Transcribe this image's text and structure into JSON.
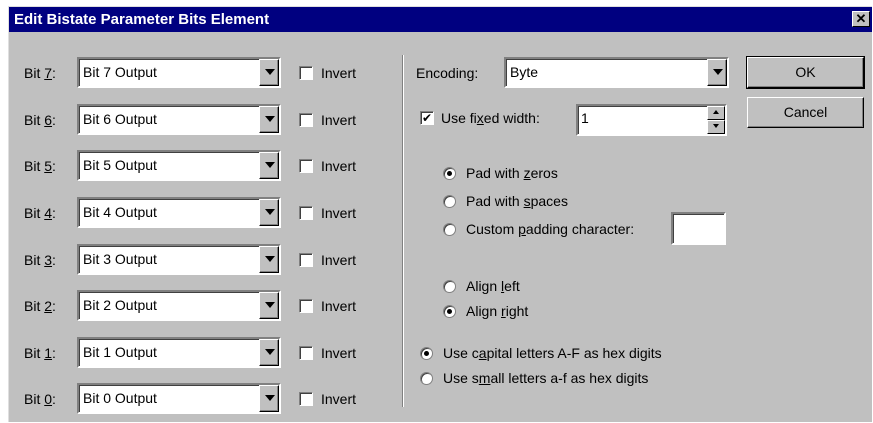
{
  "window": {
    "title": "Edit Bistate Parameter Bits Element",
    "close_label": "✕"
  },
  "bits": [
    {
      "label_pre": "Bit ",
      "label_key": "7",
      "label_post": ":",
      "value": "Bit 7 Output",
      "invert_label": "Invert",
      "invert_checked": false
    },
    {
      "label_pre": "Bit ",
      "label_key": "6",
      "label_post": ":",
      "value": "Bit 6 Output",
      "invert_label": "Invert",
      "invert_checked": false
    },
    {
      "label_pre": "Bit ",
      "label_key": "5",
      "label_post": ":",
      "value": "Bit 5 Output",
      "invert_label": "Invert",
      "invert_checked": false
    },
    {
      "label_pre": "Bit ",
      "label_key": "4",
      "label_post": ":",
      "value": "Bit 4 Output",
      "invert_label": "Invert",
      "invert_checked": false
    },
    {
      "label_pre": "Bit ",
      "label_key": "3",
      "label_post": ":",
      "value": "Bit 3 Output",
      "invert_label": "Invert",
      "invert_checked": false
    },
    {
      "label_pre": "Bit ",
      "label_key": "2",
      "label_post": ":",
      "value": "Bit 2 Output",
      "invert_label": "Invert",
      "invert_checked": false
    },
    {
      "label_pre": "Bit ",
      "label_key": "1",
      "label_post": ":",
      "value": "Bit 1 Output",
      "invert_label": "Invert",
      "invert_checked": false
    },
    {
      "label_pre": "Bit ",
      "label_key": "0",
      "label_post": ":",
      "value": "Bit 0 Output",
      "invert_label": "Invert",
      "invert_checked": false
    }
  ],
  "encoding": {
    "label": "Encoding:",
    "value": "Byte"
  },
  "fixed_width": {
    "label_pre": "Use fi",
    "label_key": "x",
    "label_post": "ed width:",
    "checked": true,
    "value": "1"
  },
  "padding": {
    "zeros": {
      "pre": "Pad with ",
      "key": "z",
      "post": "eros",
      "selected": true
    },
    "spaces": {
      "pre": "Pad with ",
      "key": "s",
      "post": "paces",
      "selected": false
    },
    "custom": {
      "pre": "Custom ",
      "key": "p",
      "post": "adding character:",
      "selected": false,
      "value": ""
    }
  },
  "align": {
    "left": {
      "pre": "Align ",
      "key": "l",
      "post": "eft",
      "selected": false
    },
    "right": {
      "pre": "Align ",
      "key": "r",
      "post": "ight",
      "selected": true
    }
  },
  "hex": {
    "capital": {
      "pre": "Use c",
      "key": "a",
      "post": "pital letters A-F as hex digits",
      "selected": true
    },
    "small": {
      "pre": "Use s",
      "key": "m",
      "post": "all letters a-f as hex digits",
      "selected": false
    }
  },
  "buttons": {
    "ok": "OK",
    "cancel": "Cancel"
  },
  "colors": {
    "titlebar": "#000080",
    "face": "#c0c0c0"
  }
}
